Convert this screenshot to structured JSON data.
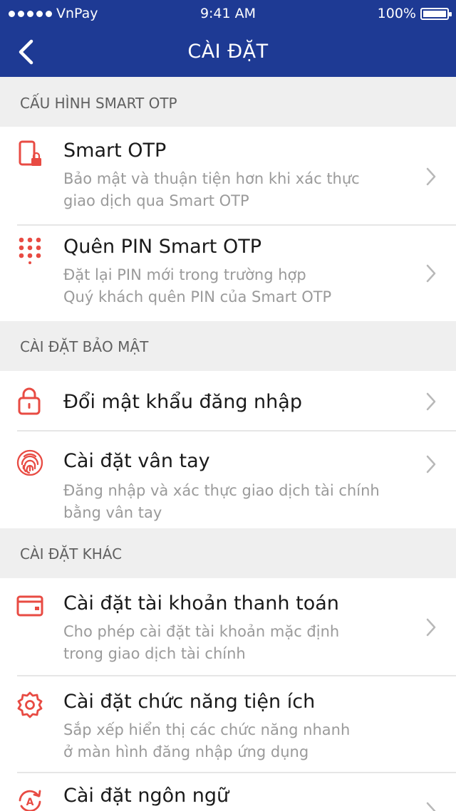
{
  "status_bar": {
    "carrier": "VnPay",
    "time": "9:41 AM",
    "battery": "100%"
  },
  "nav": {
    "title": "CÀI ĐẶT"
  },
  "sections": [
    {
      "header": "CẤU HÌNH SMART OTP",
      "items": [
        {
          "icon": "phone-lock-icon",
          "title": "Smart OTP",
          "desc": [
            "Bảo mật và thuận tiện hơn khi xác thực",
            "giao dịch qua Smart OTP"
          ]
        },
        {
          "icon": "keypad-icon",
          "title": "Quên PIN Smart OTP",
          "desc": [
            "Đặt lại PIN mới trong trường hợp",
            "Quý khách quên PIN của Smart OTP"
          ]
        }
      ]
    },
    {
      "header": "CÀI ĐẶT BẢO MẬT",
      "items": [
        {
          "icon": "lock-icon",
          "title": "Đổi mật khẩu đăng nhập",
          "desc": []
        },
        {
          "icon": "fingerprint-icon",
          "title": "Cài đặt vân tay",
          "desc": [
            "Đăng nhập và xác thực giao dịch tài chính",
            "bằng vân tay"
          ]
        }
      ]
    },
    {
      "header": "CÀI ĐẶT KHÁC",
      "items": [
        {
          "icon": "card-icon",
          "title": "Cài đặt tài khoản thanh toán",
          "desc": [
            "Cho phép cài đặt tài khoản mặc định",
            "trong giao dịch tài chính"
          ]
        },
        {
          "icon": "gear-icon",
          "title": "Cài đặt chức năng tiện ích",
          "desc": [
            "Sắp xếp hiển thị các chức năng nhanh",
            "ở màn hình đăng nhập ứng dụng"
          ]
        },
        {
          "icon": "language-icon",
          "title": "Cài đặt ngôn ngữ",
          "desc": []
        }
      ]
    }
  ],
  "colors": {
    "brand": "#1e3a94",
    "accent": "#e84b43",
    "section_bg": "#efefef"
  }
}
